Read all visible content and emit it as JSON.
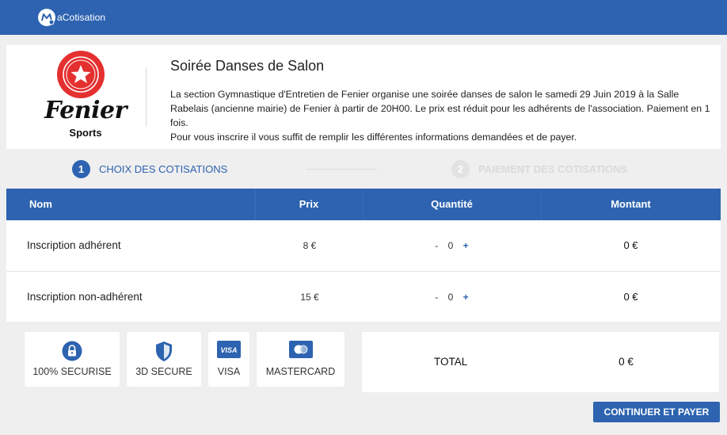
{
  "header": {
    "brand": "aCotisation"
  },
  "event": {
    "club_name": "Fenier",
    "club_sub": "Sports",
    "title": "Soirée Danses de Salon",
    "description": [
      "La section Gymnastique d'Entretien de Fenier organise une soirée danses de salon le samedi 29 Juin 2019 à la Salle Rabelais (ancienne mairie) de Fenier à partir de 20H00. Le prix est réduit pour les adhérents de l'association. Paiement en 1 fois.",
      "Pour vous inscrire il vous suffit de remplir les différentes informations demandées et de payer."
    ]
  },
  "steps": [
    {
      "num": "1",
      "label": "CHOIX DES COTISATIONS",
      "state": "active"
    },
    {
      "num": "2",
      "label": "PAIEMENT DES COTISATIONS",
      "state": "inactive"
    }
  ],
  "table": {
    "headers": {
      "name": "Nom",
      "price": "Prix",
      "qty": "Quantité",
      "amount": "Montant"
    },
    "rows": [
      {
        "name": "Inscription adhérent",
        "price": "8 €",
        "qty": "0",
        "amount": "0 €"
      },
      {
        "name": "Inscription non-adhérent",
        "price": "15 €",
        "qty": "0",
        "amount": "0 €"
      }
    ],
    "minus": "-",
    "plus": "+"
  },
  "badges": [
    {
      "label": "100% SECURISE",
      "icon": "lock-icon"
    },
    {
      "label": "3D SECURE",
      "icon": "shield-icon"
    },
    {
      "label": "VISA",
      "icon": "visa-card-icon",
      "icon_text": "VISA"
    },
    {
      "label": "MASTERCARD",
      "icon": "mastercard-icon"
    }
  ],
  "total": {
    "label": "TOTAL",
    "value": "0 €"
  },
  "cta": {
    "label": "CONTINUER ET PAYER"
  },
  "colors": {
    "primary": "#2d63b0",
    "accent_red": "#e53030",
    "background": "#efefef"
  }
}
